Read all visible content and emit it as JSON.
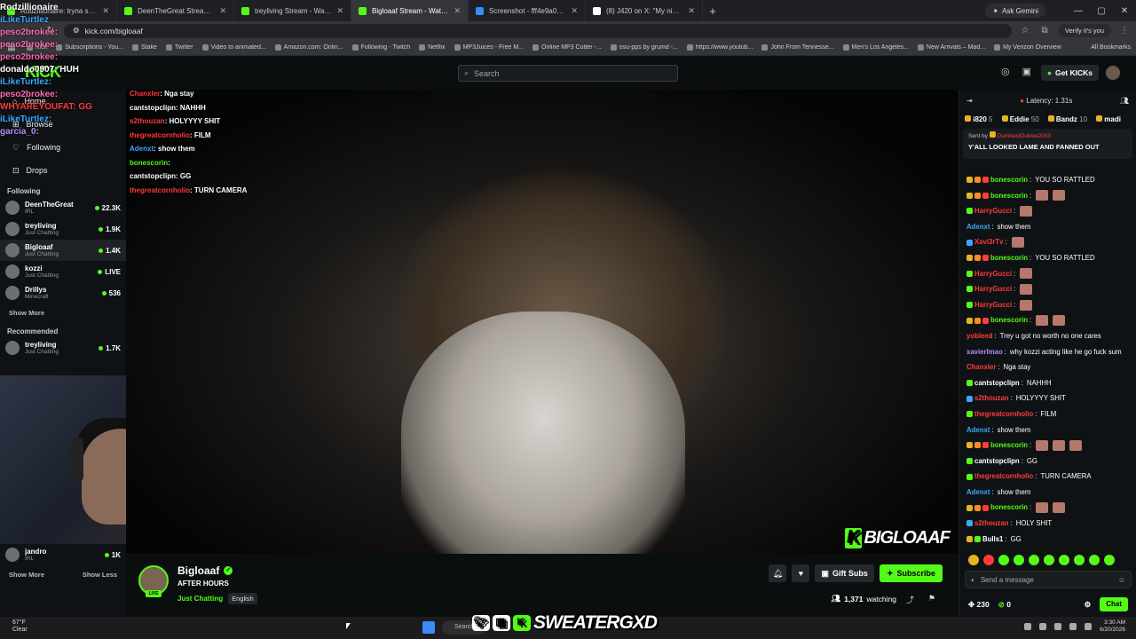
{
  "browser": {
    "tabs": [
      {
        "title": "Rodzillionaire: tryna save face",
        "icon": "kick"
      },
      {
        "title": "DeenTheGreat Stream - Watch",
        "icon": "kick"
      },
      {
        "title": "treyliving Stream - Watch Live",
        "icon": "kick"
      },
      {
        "title": "Bigloaaf Stream - Watch Live",
        "icon": "kick",
        "active": true
      },
      {
        "title": "Screenshot - fff4e9a07bf708d",
        "icon": "screenshot"
      },
      {
        "title": "(8) J420 on X: \"My nigga AB is a",
        "icon": "x"
      }
    ],
    "ask_gemini": "Ask Gemini",
    "url": "kick.com/bigloaaf",
    "profile": "Verify it's you",
    "bookmarks": [
      "Kick",
      "Subscriptions - You...",
      "Stake",
      "Twitter",
      "Video to animated...",
      "Amazon.com: Onlin...",
      "Following - Twitch",
      "Netflix",
      "MP3Juices - Free M...",
      "Online MP3 Cutter -...",
      "osu-pps by grumd -...",
      "https://www.youtub...",
      "John From Tennesse...",
      "Men's Los Angeles...",
      "New Arrivals – Mad...",
      "My Verizon Overview"
    ],
    "all_bookmarks": "All Bookmarks"
  },
  "header": {
    "logo": "KICK",
    "search_placeholder": "Search",
    "get_kicks": "Get KICKs"
  },
  "sidebar": {
    "nav": [
      {
        "label": "Home",
        "icon": "home-icon"
      },
      {
        "label": "Browse",
        "icon": "browse-icon"
      },
      {
        "label": "Following",
        "icon": "heart-icon"
      },
      {
        "label": "Drops",
        "icon": "drops-icon"
      }
    ],
    "following_header": "Following",
    "following": [
      {
        "name": "DeenTheGreat",
        "category": "IRL",
        "viewers": "22.3K"
      },
      {
        "name": "treyliving",
        "category": "Just Chatting",
        "viewers": "1.9K"
      },
      {
        "name": "Bigloaaf",
        "category": "Just Chatting",
        "viewers": "1.4K",
        "active": true
      },
      {
        "name": "kozzi",
        "category": "Just Chatting",
        "viewers": "LIVE"
      },
      {
        "name": "Drillys",
        "category": "Minecraft",
        "viewers": "536"
      }
    ],
    "show_more": "Show More",
    "recommended_header": "Recommended",
    "recommended": [
      {
        "name": "treyliving",
        "category": "Just Chatting",
        "viewers": "1.7K"
      }
    ],
    "bottom_channel": {
      "name": "jandro",
      "category": "IRL",
      "viewers": "1K"
    },
    "show_more_bottom": "Show More",
    "show_less": "Show Less"
  },
  "left_overlay": [
    {
      "text": "Rodzillionaire",
      "color": "#ffffff"
    },
    {
      "text": "iLikeTurtlez",
      "color": "#3da7ff"
    },
    {
      "text": "peso2brokee:",
      "color": "#ff69b4"
    },
    {
      "text": "peso2brokee:",
      "color": "#ff69b4"
    },
    {
      "text": "peso2brokee:",
      "color": "#ff69b4"
    },
    {
      "text": "donaldo0907: HUH",
      "color": "#ffffff"
    },
    {
      "text": "iLikeTurtlez:",
      "color": "#3da7ff"
    },
    {
      "text": "peso2brokee:",
      "color": "#ff69b4"
    },
    {
      "text": "WHYAREYOUFAT: GG",
      "color": "#ff3b3b"
    },
    {
      "text": "iLikeTurtlez:",
      "color": "#3da7ff"
    },
    {
      "text": "garcia_0:",
      "color": "#b388ff"
    }
  ],
  "stream_overlay_chat": [
    {
      "user": "Chanxler",
      "color": "red",
      "msg": "Nga stay"
    },
    {
      "user": "cantstopclipn",
      "color": "white",
      "msg": "NAHHH"
    },
    {
      "user": "s2thouzan",
      "color": "red",
      "msg": "HOLYYYY SHIT"
    },
    {
      "user": "thegreatcornholio",
      "color": "red",
      "msg": "FILM"
    },
    {
      "user": "Adenxt",
      "color": "blue",
      "msg": "show them"
    },
    {
      "user": "bonescorin",
      "color": "green",
      "msg": ""
    },
    {
      "user": "cantstopclipn",
      "color": "white",
      "msg": "GG"
    },
    {
      "user": "thegreatcornholio",
      "color": "red",
      "msg": "TURN CAMERA"
    }
  ],
  "video": {
    "watermark_k": "K",
    "watermark": "BIGLOAAF"
  },
  "stream": {
    "streamer": "Bigloaaf",
    "live_badge": "LIVE",
    "title": "AFTER HOURS",
    "category": "Just Chatting",
    "language": "English",
    "gift_subs": "Gift Subs",
    "subscribe": "Subscribe",
    "watching_count": "1,371",
    "watching_label": "watching"
  },
  "chat": {
    "latency": "Latency: 1.31s",
    "leaders": [
      {
        "name": "i820",
        "count": "5"
      },
      {
        "name": "Eddie",
        "count": "50"
      },
      {
        "name": "Bandz",
        "count": "10"
      },
      {
        "name": "madi",
        "count": ""
      }
    ],
    "pinned_sent_by": "Sent by",
    "pinned_user": "DumbestDukkie2003",
    "pinned_msg": "Y'ALL LOOKED LAME AND FANNED OUT",
    "messages": [
      {
        "badges": [
          "gold",
          "orange",
          "red"
        ],
        "user": "bonescorin",
        "color": "green",
        "msg": "YOU SO RATTLED",
        "emotes": 0
      },
      {
        "badges": [
          "gold",
          "orange",
          "red"
        ],
        "user": "bonescorin",
        "color": "green",
        "msg": "",
        "emotes": 2
      },
      {
        "badges": [
          "green"
        ],
        "user": "HarryGucci",
        "color": "red",
        "msg": "",
        "emotes": 1
      },
      {
        "badges": [],
        "user": "Adenxt",
        "color": "blue",
        "msg": "show them",
        "emotes": 0
      },
      {
        "badges": [
          "blue"
        ],
        "user": "Xavi3rTv",
        "color": "red",
        "msg": "",
        "emotes": 1
      },
      {
        "badges": [
          "gold",
          "orange",
          "red"
        ],
        "user": "bonescorin",
        "color": "green",
        "msg": "YOU SO RATTLED",
        "emotes": 0
      },
      {
        "badges": [
          "green"
        ],
        "user": "HarryGucci",
        "color": "red",
        "msg": "",
        "emotes": 1
      },
      {
        "badges": [
          "green"
        ],
        "user": "HarryGucci",
        "color": "red",
        "msg": "",
        "emotes": 1
      },
      {
        "badges": [
          "green"
        ],
        "user": "HarryGucci",
        "color": "red",
        "msg": "",
        "emotes": 1
      },
      {
        "badges": [
          "gold",
          "orange",
          "red"
        ],
        "user": "bonescorin",
        "color": "green",
        "msg": "",
        "emotes": 2
      },
      {
        "badges": [],
        "user": "yobleed",
        "color": "red",
        "msg": "Trey u got no worth no one cares",
        "emotes": 0
      },
      {
        "badges": [],
        "user": "xavierlmao",
        "color": "purple",
        "msg": "why kozzi acting like he go fuck sum",
        "emotes": 0
      },
      {
        "badges": [],
        "user": "Chanxler",
        "color": "red",
        "msg": "Nga stay",
        "emotes": 0
      },
      {
        "badges": [
          "green"
        ],
        "user": "cantstopclipn",
        "color": "white",
        "msg": "NAHHH",
        "emotes": 0
      },
      {
        "badges": [
          "blue"
        ],
        "user": "s2thouzan",
        "color": "red",
        "msg": "HOLYYYY SHIT",
        "emotes": 0
      },
      {
        "badges": [
          "green"
        ],
        "user": "thegreatcornholio",
        "color": "red",
        "msg": "FILM",
        "emotes": 0
      },
      {
        "badges": [],
        "user": "Adenxt",
        "color": "blue",
        "msg": "show them",
        "emotes": 0
      },
      {
        "badges": [
          "gold",
          "orange",
          "red"
        ],
        "user": "bonescorin",
        "color": "green",
        "msg": "",
        "emotes": 3
      },
      {
        "badges": [
          "green"
        ],
        "user": "cantstopclipn",
        "color": "white",
        "msg": "GG",
        "emotes": 0
      },
      {
        "badges": [
          "green"
        ],
        "user": "thegreatcornholio",
        "color": "red",
        "msg": "TURN CAMERA",
        "emotes": 0
      },
      {
        "badges": [],
        "user": "Adenxt",
        "color": "blue",
        "msg": "show them",
        "emotes": 0
      },
      {
        "badges": [
          "gold",
          "orange",
          "red"
        ],
        "user": "bonescorin",
        "color": "green",
        "msg": "",
        "emotes": 2
      },
      {
        "badges": [
          "blue"
        ],
        "user": "s2thouzan",
        "color": "red",
        "msg": "HOLY SHIT",
        "emotes": 0
      },
      {
        "badges": [
          "gold",
          "green"
        ],
        "user": "Bulls1",
        "color": "white",
        "msg": "GG",
        "emotes": 0
      }
    ],
    "input_placeholder": "Send a message",
    "kicks_count": "230",
    "points": "0",
    "chat_button": "Chat"
  },
  "taskbar": {
    "temp": "67°F",
    "weather": "Clear",
    "search": "Search",
    "overlay_name": "SWEATERGXD",
    "time": "3:30 AM",
    "date": "6/20/2026"
  }
}
